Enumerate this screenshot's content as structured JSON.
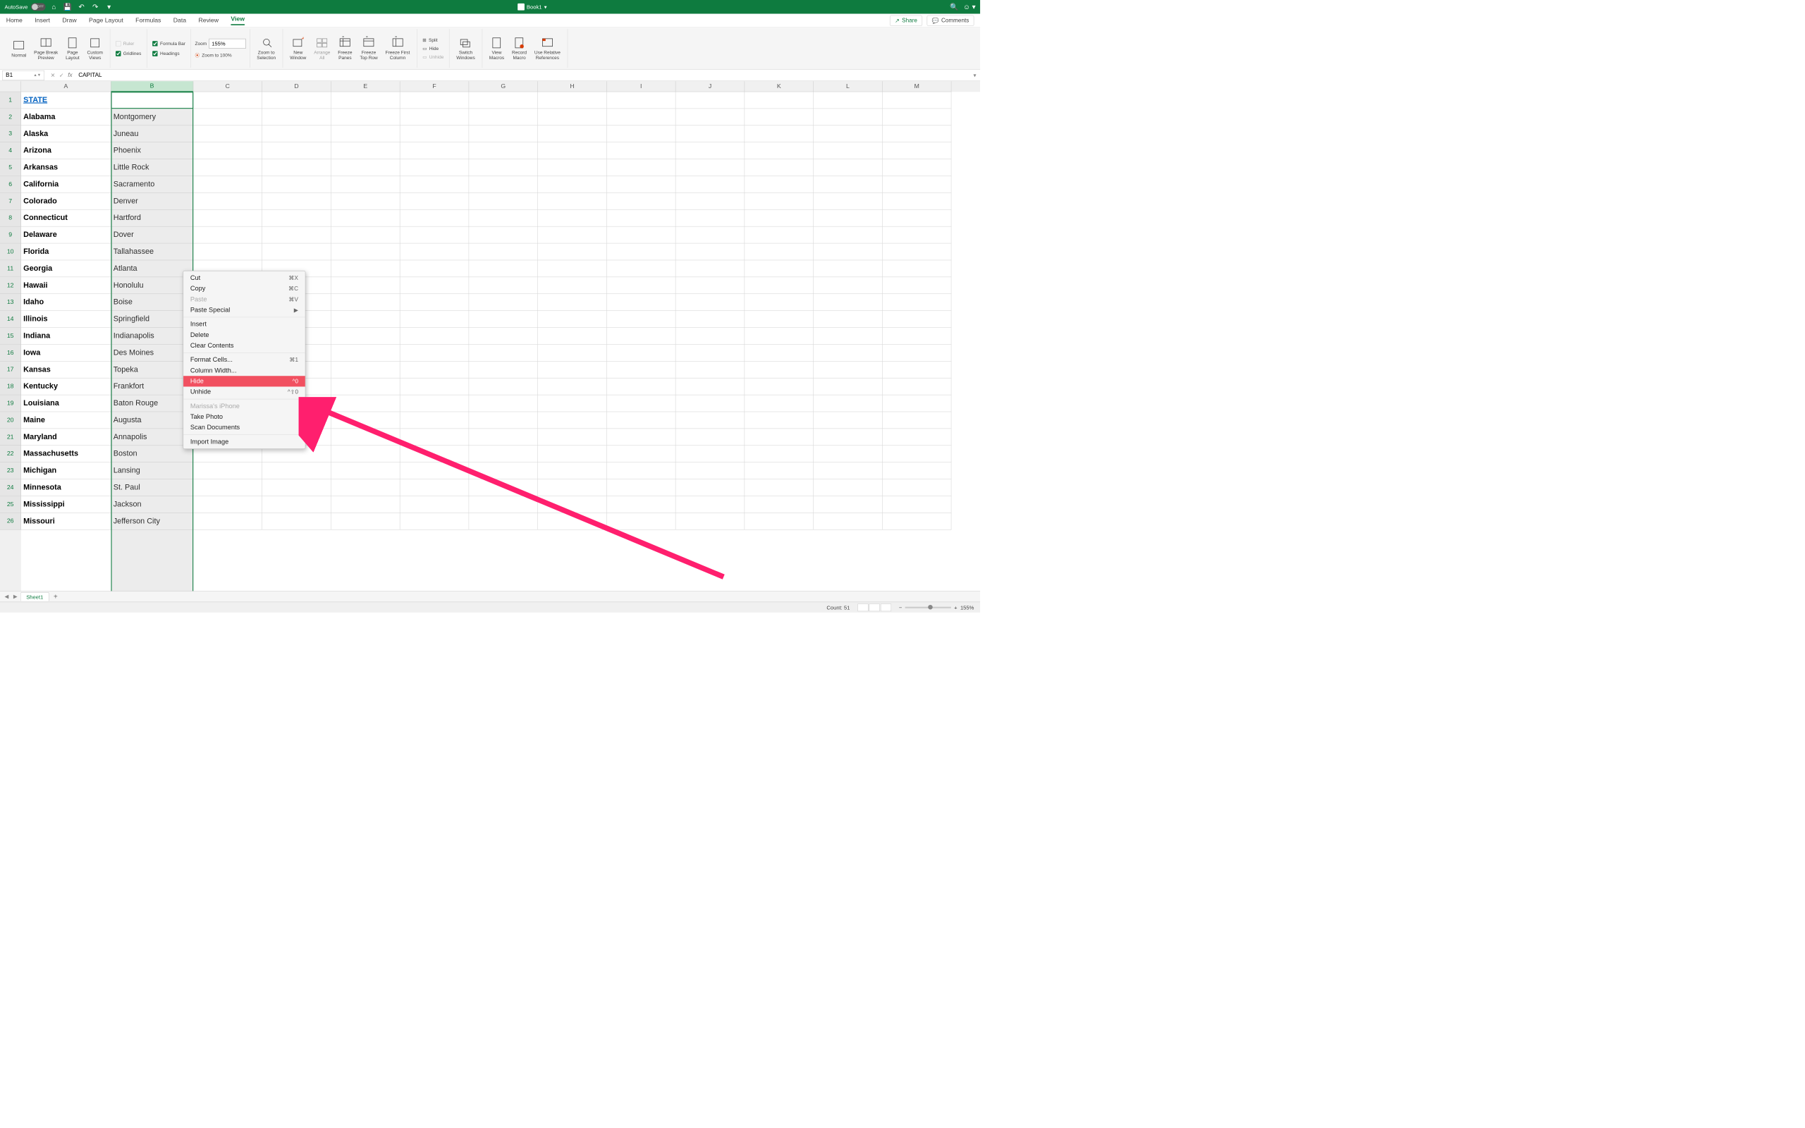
{
  "titlebar": {
    "autosave": "AutoSave",
    "autosave_state": "OFF",
    "doc_title": "Book1"
  },
  "tabs": [
    "Home",
    "Insert",
    "Draw",
    "Page Layout",
    "Formulas",
    "Data",
    "Review",
    "View"
  ],
  "active_tab": "View",
  "share": "Share",
  "comments": "Comments",
  "ribbon": {
    "normal": "Normal",
    "page_break": "Page Break\nPreview",
    "page_layout": "Page\nLayout",
    "custom_views": "Custom\nViews",
    "ruler": "Ruler",
    "gridlines": "Gridlines",
    "formula_bar": "Formula Bar",
    "headings": "Headings",
    "zoom": "Zoom",
    "zoom_value": "155%",
    "zoom_100": "Zoom to 100%",
    "zoom_sel": "Zoom to\nSelection",
    "new_window": "New\nWindow",
    "arrange_all": "Arrange\nAll",
    "freeze_panes": "Freeze\nPanes",
    "freeze_top": "Freeze\nTop Row",
    "freeze_first": "Freeze First\nColumn",
    "split": "Split",
    "hide": "Hide",
    "unhide": "Unhide",
    "switch": "Switch\nWindows",
    "view_macros": "View\nMacros",
    "record_macro": "Record\nMacro",
    "use_rel": "Use Relative\nReferences"
  },
  "formula": {
    "namebox": "B1",
    "value": "CAPITAL"
  },
  "columns": [
    "A",
    "B",
    "C",
    "D",
    "E",
    "F",
    "G",
    "H",
    "I",
    "J",
    "K",
    "L",
    "M"
  ],
  "selected_col": "B",
  "col_widths": {
    "A": 235,
    "B": 215,
    "rest": 180
  },
  "headers": {
    "state": "STATE",
    "capital": "CAPITAL"
  },
  "rows": [
    {
      "state": "Alabama",
      "capital": "Montgomery"
    },
    {
      "state": "Alaska",
      "capital": "Juneau"
    },
    {
      "state": "Arizona",
      "capital": "Phoenix"
    },
    {
      "state": "Arkansas",
      "capital": "Little Rock"
    },
    {
      "state": "California",
      "capital": "Sacramento"
    },
    {
      "state": "Colorado",
      "capital": "Denver"
    },
    {
      "state": "Connecticut",
      "capital": "Hartford"
    },
    {
      "state": "Delaware",
      "capital": "Dover"
    },
    {
      "state": "Florida",
      "capital": "Tallahassee"
    },
    {
      "state": "Georgia",
      "capital": "Atlanta"
    },
    {
      "state": "Hawaii",
      "capital": "Honolulu"
    },
    {
      "state": "Idaho",
      "capital": "Boise"
    },
    {
      "state": "Illinois",
      "capital": "Springfield"
    },
    {
      "state": "Indiana",
      "capital": "Indianapolis"
    },
    {
      "state": "Iowa",
      "capital": "Des Moines"
    },
    {
      "state": "Kansas",
      "capital": "Topeka"
    },
    {
      "state": "Kentucky",
      "capital": "Frankfort"
    },
    {
      "state": "Louisiana",
      "capital": "Baton Rouge"
    },
    {
      "state": "Maine",
      "capital": "Augusta"
    },
    {
      "state": "Maryland",
      "capital": "Annapolis"
    },
    {
      "state": "Massachusetts",
      "capital": "Boston"
    },
    {
      "state": "Michigan",
      "capital": "Lansing"
    },
    {
      "state": "Minnesota",
      "capital": "St. Paul"
    },
    {
      "state": "Mississippi",
      "capital": "Jackson"
    },
    {
      "state": "Missouri",
      "capital": "Jefferson City"
    }
  ],
  "context_menu": [
    {
      "label": "Cut",
      "sc": "⌘X"
    },
    {
      "label": "Copy",
      "sc": "⌘C"
    },
    {
      "label": "Paste",
      "sc": "⌘V",
      "disabled": true
    },
    {
      "label": "Paste Special",
      "submenu": true
    },
    {
      "sep": true
    },
    {
      "label": "Insert"
    },
    {
      "label": "Delete"
    },
    {
      "label": "Clear Contents"
    },
    {
      "sep": true
    },
    {
      "label": "Format Cells...",
      "sc": "⌘1"
    },
    {
      "label": "Column Width..."
    },
    {
      "label": "Hide",
      "sc": "^0",
      "hover": true
    },
    {
      "label": "Unhide",
      "sc": "^⇧0"
    },
    {
      "sep": true
    },
    {
      "label": "Marissa's iPhone",
      "disabled": true
    },
    {
      "label": "Take Photo"
    },
    {
      "label": "Scan Documents"
    },
    {
      "sep": true
    },
    {
      "label": "Import Image"
    }
  ],
  "sheet": "Sheet1",
  "status": {
    "count_label": "Count:",
    "count": "51",
    "zoom": "155%"
  }
}
